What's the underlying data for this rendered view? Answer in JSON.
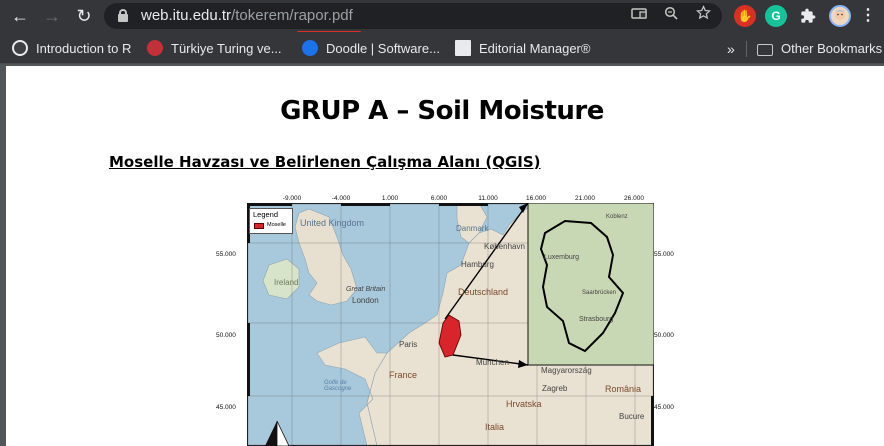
{
  "browser": {
    "url_host": "web.itu.edu.tr",
    "url_path": "/tokerem/rapor.pdf",
    "nav": {
      "back": "←",
      "forward": "→",
      "reload": "↻"
    },
    "extensions": [
      {
        "name": "adblock-icon",
        "glyph": "✋",
        "color": "#d93025"
      },
      {
        "name": "grammarly-icon",
        "glyph": "G",
        "color": "#15c39a"
      }
    ]
  },
  "bookmarks": {
    "items": [
      {
        "label": "Introduction to R",
        "icon": "globe-icon",
        "color": "#8ab4f8"
      },
      {
        "label": "Türkiye Turing ve...",
        "icon": "turing-logo-icon",
        "color": "#c2313a"
      },
      {
        "label": "Doodle | Software...",
        "icon": "doodle-logo-icon",
        "color": "#1a73e8"
      },
      {
        "label": "Editorial Manager®",
        "icon": "editorial-manager-icon",
        "color": "#e8eaed"
      }
    ],
    "overflow": "»",
    "other": "Other Bookmarks"
  },
  "document": {
    "title": "GRUP A – Soil Moisture",
    "subtitle": "Moselle Havzası ve Belirlenen Çalışma Alanı (QGIS)"
  },
  "map": {
    "lon_ticks": [
      "-9.000",
      "-4.000",
      "1.000",
      "6.000",
      "11.000",
      "16.000",
      "21.000",
      "26.000"
    ],
    "lat_ticks": [
      "55.000",
      "50.000",
      "45.000"
    ],
    "legend": {
      "title": "Legend",
      "label": "Moselle"
    },
    "places": {
      "uk": "United Kingdom",
      "ireland": "Ireland",
      "britain": "Great Britain",
      "london": "London",
      "paris": "Paris",
      "france": "France",
      "danmark": "Danmark",
      "kobenhavn": "København",
      "hamburg": "Hamburg",
      "deutschland": "Deutschland",
      "munchen": "München",
      "magyarorszag": "Magyarország",
      "zagreb": "Zagreb",
      "romania": "România",
      "hrvatska": "Hrvatska",
      "italia": "Italia",
      "bucure": "Bucure",
      "biscay": "Golfe de Gascogne",
      "inset_koblenz": "Koblenz",
      "inset_luxembourg": "Luxemburg",
      "inset_saarbrucken": "Saarbrücken",
      "inset_strasbourg": "Strasbourg"
    }
  }
}
